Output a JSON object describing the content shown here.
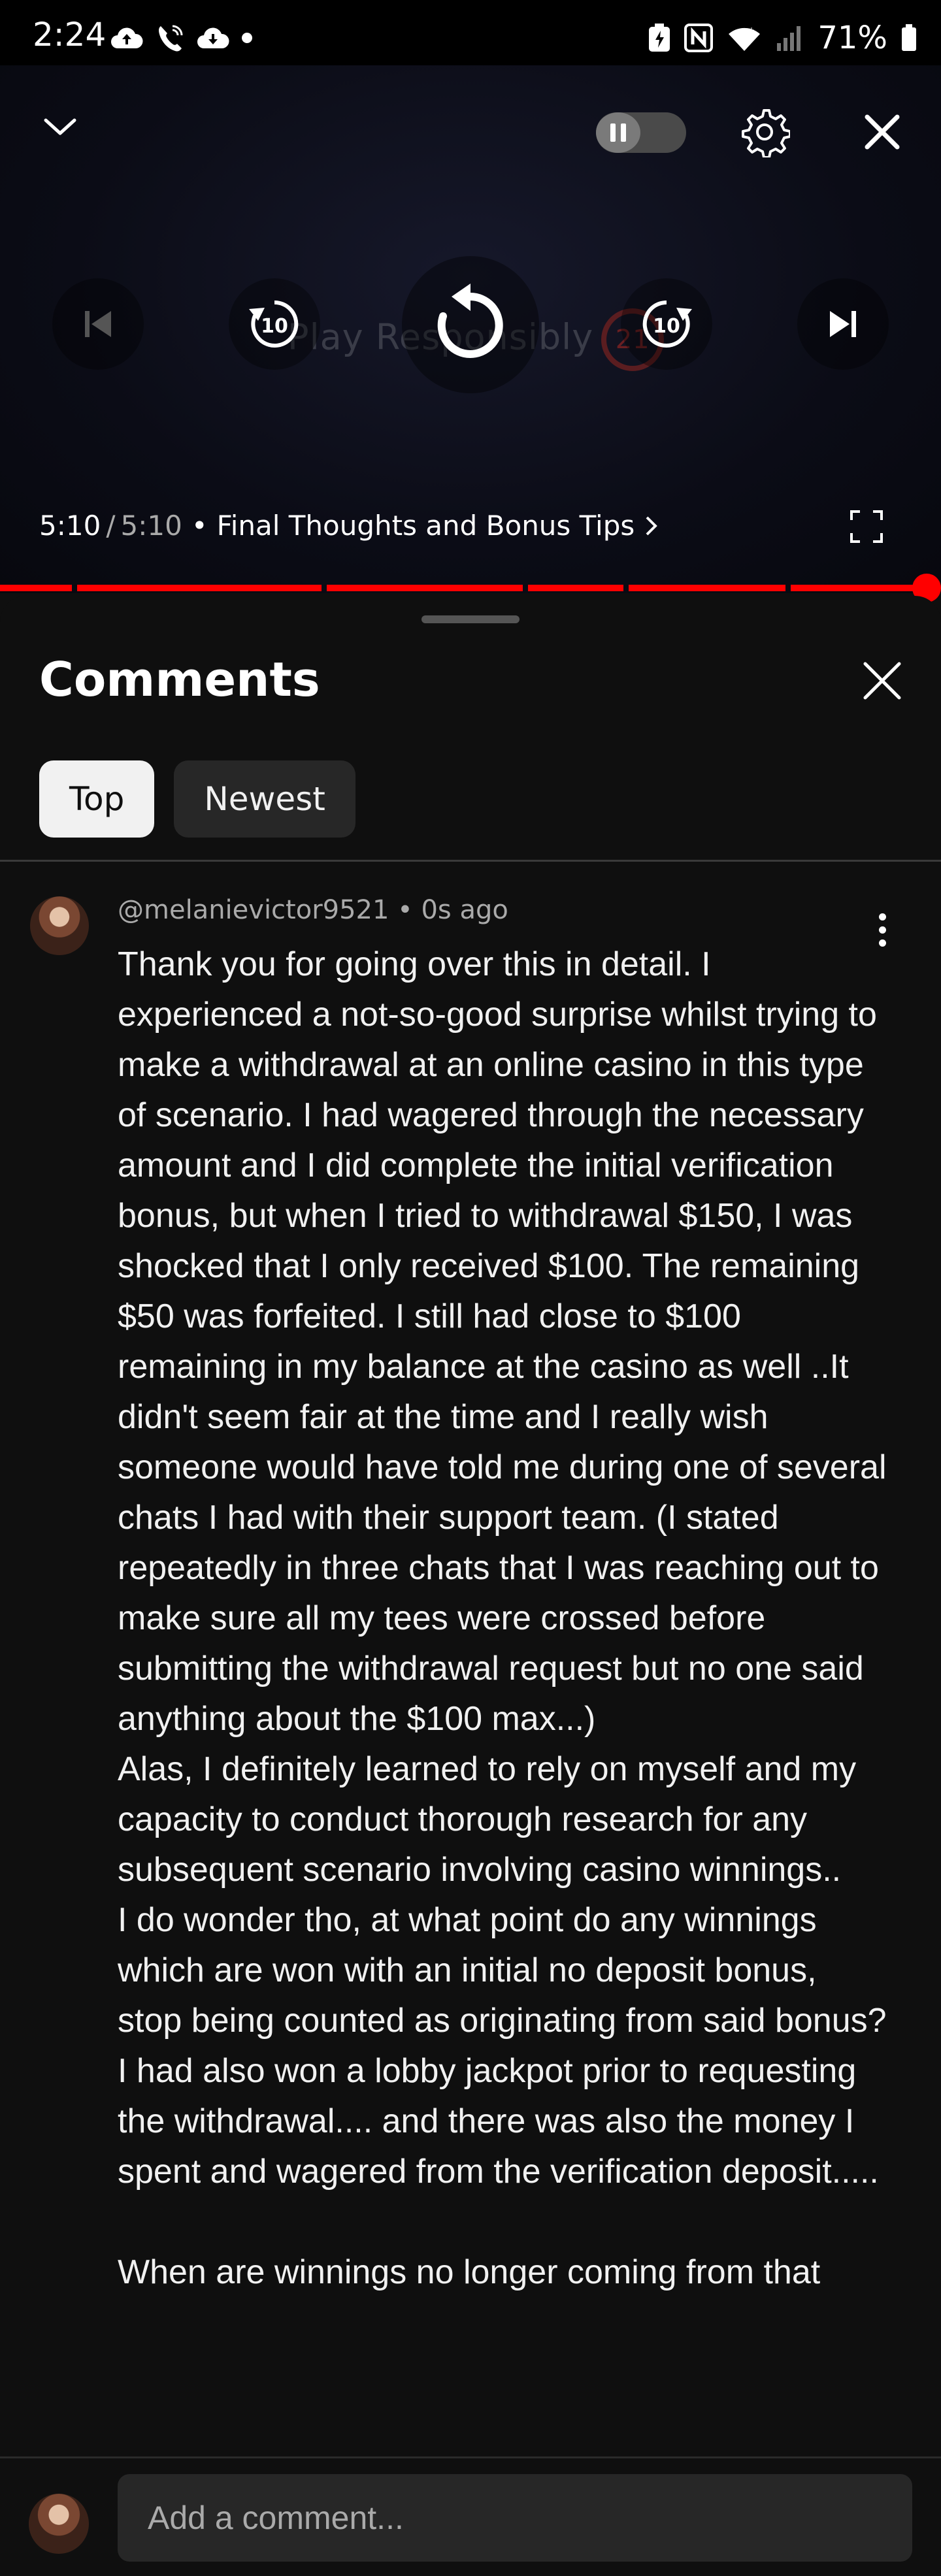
{
  "status_bar": {
    "time": "2:24",
    "battery": "71%",
    "icons": [
      "cloud-upload-icon",
      "wifi-call-icon",
      "cloud-icon",
      "dot-icon",
      "battery-saver-icon",
      "nfc-icon",
      "wifi-icon",
      "signal-icon",
      "battery-icon"
    ]
  },
  "player": {
    "watermark_text": "Play Responsibly",
    "watermark_age": "21",
    "current_time": "5:10",
    "duration": "5:10",
    "chapter": "Final Thoughts and Bonus Tips",
    "progress": 1.0,
    "accent_color": "#ff0000",
    "icons": [
      "chevron-down-icon",
      "autoplay-toggle",
      "settings-gear-icon",
      "close-icon",
      "previous-icon",
      "rewind-10-icon",
      "replay-icon",
      "forward-10-icon",
      "next-icon",
      "fullscreen-icon"
    ]
  },
  "comments_panel": {
    "title": "Comments",
    "tabs": [
      {
        "label": "Top",
        "active": true
      },
      {
        "label": "Newest",
        "active": false
      }
    ],
    "comment": {
      "author": "@melanievictor9521",
      "time_ago": "0s ago",
      "paragraphs": [
        "Thank you for going over this in detail. I experienced a not-so-good surprise whilst trying to make a withdrawal at an online casino in this type of scenario. I had wagered through the necessary amount and I did complete the initial verification bonus, but when I tried to withdrawal $150, I was shocked that I only received $100. The remaining $50 was forfeited. I still had close to $100 remaining in my balance at the casino as well ..It didn't seem fair at the time and I really wish someone would have told me during one of several chats I had with their support team. (I stated repeatedly in three chats that I was reaching out to make sure all my tees were crossed before submitting the withdrawal request but no one said anything about the $100 max...)",
        "Alas, I definitely learned to rely on myself and my capacity to conduct thorough research for any subsequent scenario involving casino winnings..",
        "I do wonder tho, at what point do any winnings which are won with an initial no deposit bonus, stop being counted as originating from said bonus? I had also won a lobby jackpot prior to requesting the withdrawal.... and there was also the money I spent and wagered from the verification deposit.....",
        "When are winnings no longer coming from that"
      ]
    },
    "add_comment_placeholder": "Add a comment..."
  }
}
